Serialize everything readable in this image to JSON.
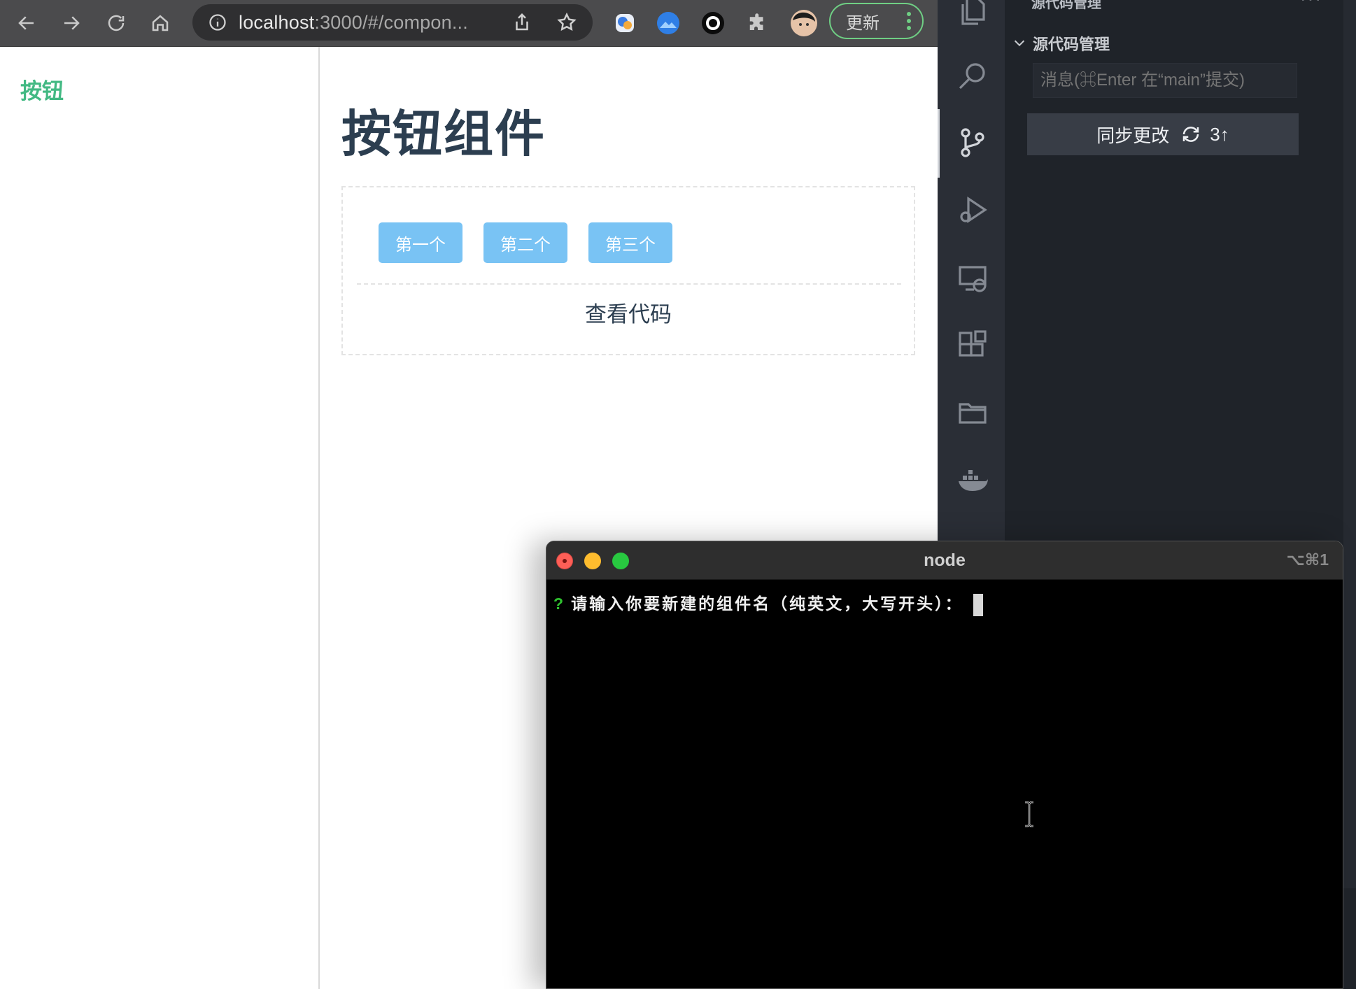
{
  "browser": {
    "url_host": "localhost",
    "url_rest": ":3000/#/compon...",
    "update_label": "更新"
  },
  "sidebar": {
    "items": [
      {
        "label": "按钮"
      }
    ]
  },
  "content": {
    "title": "按钮组件",
    "buttons": [
      {
        "label": "第一个"
      },
      {
        "label": "第二个"
      },
      {
        "label": "第三个"
      }
    ],
    "view_code": "查看代码",
    "colors": {
      "link": "#42b983",
      "button": "#79c3f4",
      "text": "#2c3e50"
    }
  },
  "vscode": {
    "panel_top_title": "源代码管理",
    "scm_title": "源代码管理",
    "commit_placeholder": "消息(⌘Enter 在“main”提交)",
    "sync_label": "同步更改",
    "sync_count": "3↑",
    "activity_icons": [
      "files-icon",
      "search-icon",
      "source-control-icon",
      "run-debug-icon",
      "remote-explorer-icon",
      "extensions-icon",
      "folder-icon",
      "docker-icon"
    ]
  },
  "terminal": {
    "title": "node",
    "shortcut": "⌥⌘1",
    "prompt_mark": "?",
    "prompt_text": "请输入你要新建的组件名（纯英文，大写开头）："
  }
}
